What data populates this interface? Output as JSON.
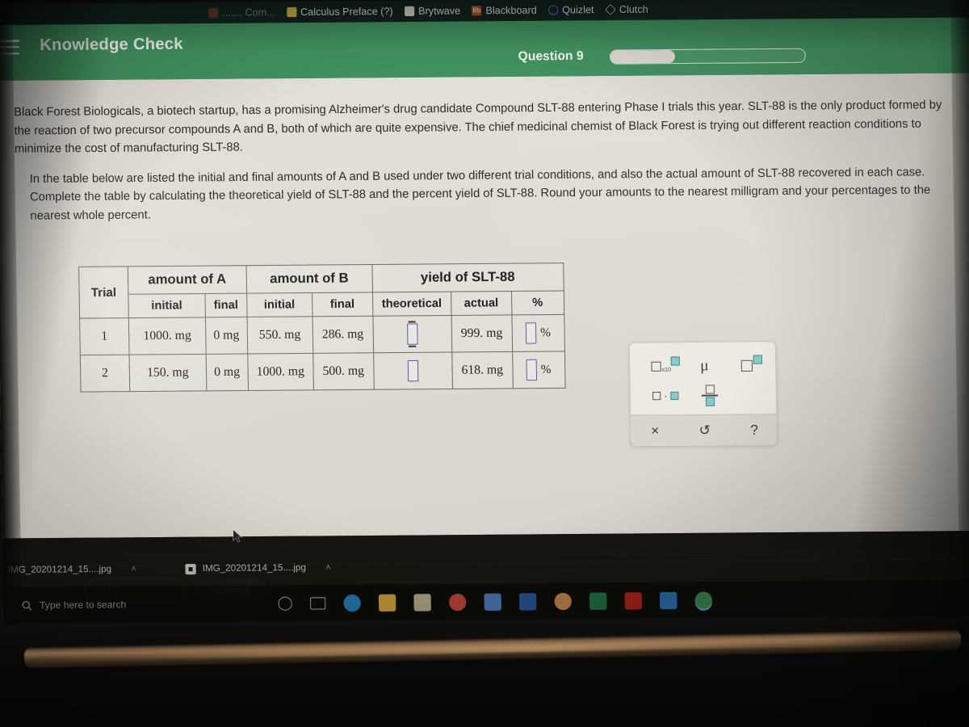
{
  "browser": {
    "bookmarks": [
      {
        "label": "Calculus Preface (?)",
        "icon": "yellow-bookmark-icon",
        "color": "#d9c04a"
      },
      {
        "label": "Brytwave",
        "icon": "document-icon",
        "color": "#e2e0d4"
      },
      {
        "label": "Blackboard",
        "icon": "blackboard-icon",
        "color": "#b5521d"
      },
      {
        "label": "Quizlet",
        "icon": "quizlet-icon",
        "color": "#4257b2"
      },
      {
        "label": "Clutch",
        "icon": "clutch-diamond-icon",
        "color": "#3c3c3c"
      }
    ]
  },
  "header": {
    "menu_icon": "hamburger-icon",
    "title": "Knowledge Check",
    "question_label": "Question 9",
    "progress_percent": 33,
    "accent_color": "#41915f"
  },
  "question": {
    "paragraph1": "Black Forest Biologicals, a biotech startup, has a promising Alzheimer's drug candidate Compound SLT-88 entering Phase I trials this year. SLT-88 is the only product formed by the reaction of two precursor compounds A and B, both of which are quite expensive. The chief medicinal chemist of Black Forest is trying out different reaction conditions to minimize the cost of manufacturing SLT-88.",
    "paragraph2": "In the table below are listed the initial and final amounts of A and B used under two different trial conditions, and also the actual amount of SLT-88 recovered in each case. Complete the table by calculating the theoretical yield of SLT-88 and the percent yield of SLT-88. Round your amounts to the nearest milligram and your percentages to the nearest whole percent."
  },
  "table": {
    "trial_header": "Trial",
    "group_headers": [
      "amount of A",
      "amount of B",
      "yield of SLT-88"
    ],
    "sub_headers": [
      "initial",
      "final",
      "initial",
      "final",
      "theoretical",
      "actual",
      "%"
    ],
    "percent_sign": "%",
    "rows": [
      {
        "trial": "1",
        "a_initial": "1000. mg",
        "a_final": "0 mg",
        "b_initial": "550. mg",
        "b_final": "286. mg",
        "theoretical": "",
        "actual": "999. mg",
        "percent": ""
      },
      {
        "trial": "2",
        "a_initial": "150. mg",
        "a_final": "0 mg",
        "b_initial": "1000. mg",
        "b_final": "500. mg",
        "theoretical": "",
        "actual": "618. mg",
        "percent": ""
      }
    ],
    "input_border_color": "#5f5fa8"
  },
  "tool_palette": {
    "buttons": [
      {
        "name": "scientific-notation-button",
        "label": "x10"
      },
      {
        "name": "micro-prefix-button",
        "label": "μ"
      },
      {
        "name": "exponent-button",
        "label": ""
      },
      {
        "name": "multiply-dot-button",
        "label": "·"
      },
      {
        "name": "fraction-button",
        "label": ""
      }
    ],
    "footer": [
      {
        "name": "clear-button",
        "glyph": "×"
      },
      {
        "name": "undo-button",
        "glyph": "↺"
      },
      {
        "name": "help-button",
        "glyph": "?"
      }
    ],
    "teal_color": "#8cc9c6"
  },
  "actions": {
    "dont_know_label": "I Don't Know",
    "submit_label": "Submit",
    "submit_color": "#1d4436"
  },
  "footer": {
    "copyright": "© 2020 McGraw-Hill Education. All Rights Reserved.",
    "links": [
      "Terms of Use",
      "Privacy",
      "Accessibility"
    ],
    "separator": "|"
  },
  "os": {
    "downloads": [
      {
        "filename": "IMG_20201214_15....jpg",
        "caret": "˄"
      },
      {
        "filename": "IMG_20201214_15....jpg",
        "caret": "˄"
      }
    ],
    "taskbar": {
      "search_placeholder": "Type here to search",
      "search_icon": "magnifier-icon",
      "cortana_icon": "cortana-circle-icon",
      "task_view_icon": "task-view-icon",
      "apps": [
        {
          "name": "edge-icon",
          "color": "#2e7cb8"
        },
        {
          "name": "file-explorer-icon",
          "color": "#d6a63f"
        },
        {
          "name": "microsoft-store-icon",
          "color": "#b9ae8e"
        },
        {
          "name": "chrome-icon",
          "color": "#c2483a"
        },
        {
          "name": "calculator-icon",
          "color": "#4e7dbe"
        },
        {
          "name": "word-icon",
          "color": "#2a5699"
        },
        {
          "name": "paint-3d-icon",
          "color": "#c98a4b"
        },
        {
          "name": "excel-icon",
          "color": "#217346"
        },
        {
          "name": "acrobat-icon",
          "color": "#b1211c"
        },
        {
          "name": "mail-icon",
          "color": "#2f6fb5"
        },
        {
          "name": "chrome-active-icon",
          "color": "#3f8a4f"
        }
      ]
    }
  }
}
